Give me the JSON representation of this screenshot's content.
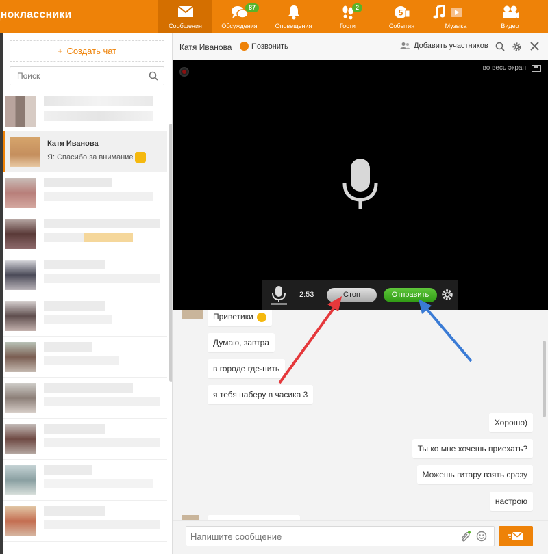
{
  "topbar": {
    "logo": "Одноклассники",
    "nav": [
      {
        "icon": "envelope-icon",
        "label": "Сообщения",
        "active": true,
        "badge": ""
      },
      {
        "icon": "discussions-icon",
        "label": "Обсуждения",
        "active": false,
        "badge": "87"
      },
      {
        "icon": "bell-icon",
        "label": "Оповещения",
        "active": false,
        "badge": ""
      },
      {
        "icon": "footprints-icon",
        "label": "Гости",
        "active": false,
        "badge": "2"
      },
      {
        "icon": "events-icon",
        "label": "События",
        "active": false,
        "badge": ""
      },
      {
        "icon": "music-note-icon",
        "label": "Музыка",
        "active": false,
        "badge": ""
      },
      {
        "icon": "video-camera-icon",
        "label": "Видео",
        "active": false,
        "badge": ""
      }
    ]
  },
  "sidebar": {
    "create_chat": "Создать чат",
    "search_placeholder": "Поиск",
    "active_chat": {
      "name": "Катя Иванова",
      "preview": "Я: Спасибо за внимание"
    }
  },
  "chat": {
    "header": {
      "name": "Катя Иванова",
      "call": "Позвонить",
      "add_participants": "Добавить участников"
    },
    "video": {
      "fullscreen": "во весь экран",
      "timer": "2:53",
      "stop": "Стоп",
      "send": "Отправить"
    },
    "messages_in": [
      "Приветики",
      "Думаю, завтра",
      "в городе где-нить",
      "я тебя наберу в часика 3"
    ],
    "messages_out": [
      "Хорошо)",
      "Ты ко мне хочешь приехать?",
      "Можешь гитару взять сразу",
      "настрою"
    ],
    "input_placeholder": "Напишите сообщение"
  },
  "colors": {
    "brand": "#ee8208",
    "badge": "#59b329",
    "send_button": "#3aad1c",
    "arrow_red": "#e5383b",
    "arrow_blue": "#3a7bd5"
  }
}
